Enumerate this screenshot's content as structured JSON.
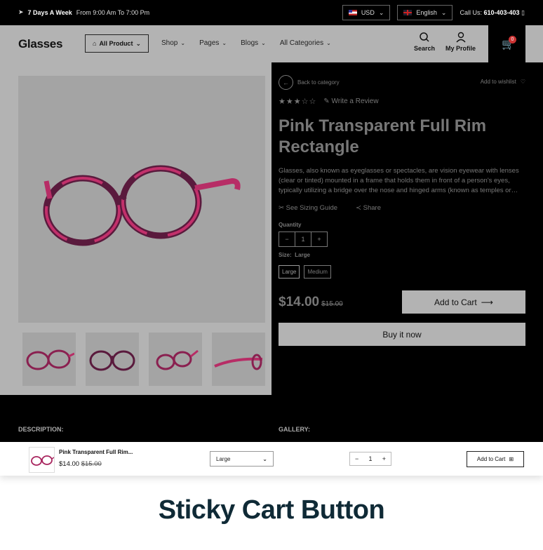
{
  "topbar": {
    "hours_bold": "7 Days A Week",
    "hours_text": "From 9:00 Am To 7:00 Pm",
    "currency": "USD",
    "language": "English",
    "call_label": "Call Us:",
    "call_number": "610-403-403"
  },
  "header": {
    "logo": "Glasses",
    "all_product": "All Product",
    "nav": [
      "Shop",
      "Pages",
      "Blogs",
      "All Categories"
    ],
    "search_label": "Search",
    "profile_label": "My Profile",
    "cart_count": "0"
  },
  "product": {
    "back_label": "Back to category",
    "wishlist_label": "Add to wishlist",
    "stars": "★★★☆☆",
    "rating": 3,
    "review_label": "Write a Review",
    "title": "Pink Transparent Full Rim Rectangle",
    "description": "Glasses, also known as eyeglasses or spectacles, are vision eyewear with lenses (clear or tinted) mounted in a frame that holds them in front of a person's eyes, typically utilizing a bridge over the nose and hinged arms (known as temples or…",
    "sizing_label": "See Sizing Guide",
    "share_label": "Share",
    "quantity_label": "Quantity",
    "quantity": "1",
    "size_label": "Size:",
    "size_value": "Large",
    "sizes": [
      "Large",
      "Medium"
    ],
    "price": "$14.00",
    "old_price": "$15.00",
    "add_to_cart": "Add to Cart",
    "buy_now": "Buy it now"
  },
  "sections": {
    "description": "DESCRIPTION:",
    "gallery": "GALLERY:"
  },
  "sticky": {
    "name": "Pink Transparent Full Rim...",
    "price": "$14.00",
    "old_price": "$15.00",
    "size": "Large",
    "quantity": "1",
    "add_to_cart": "Add to Cart"
  },
  "feature_title": "Sticky Cart Button",
  "colors": {
    "frame": "#a8245e",
    "frame_dark": "#5a1a3d",
    "heading": "#0f2a36"
  }
}
